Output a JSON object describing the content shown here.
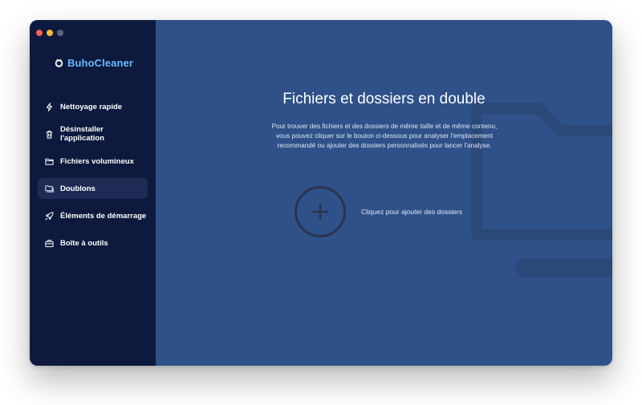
{
  "window": {
    "traffic_lights": [
      "red",
      "yellow",
      "gray"
    ]
  },
  "sidebar": {
    "brand": "BuhoCleaner",
    "items": [
      {
        "label": "Nettoyage rapide",
        "icon": "lightning-icon",
        "active": false
      },
      {
        "label": "Désinstaller l'application",
        "icon": "trash-icon",
        "active": false
      },
      {
        "label": "Fichiers volumineux",
        "icon": "folder-icon",
        "active": false
      },
      {
        "label": "Doublons",
        "icon": "duplicate-folder-icon",
        "active": true
      },
      {
        "label": "Éléments de démarrage",
        "icon": "rocket-icon",
        "active": false
      },
      {
        "label": "Boîte à outils",
        "icon": "toolbox-icon",
        "active": false
      }
    ]
  },
  "main": {
    "title": "Fichiers et dossiers en double",
    "description": "Pour trouver des fichiers et des dossiers de même taille et de même contenu, vous pouvez cliquer sur le bouton ci-dessous pour analyser l'emplacement recommandé ou ajouter des dossiers personnalisés pour lancer l'analyse.",
    "add_button_icon": "plus-icon",
    "add_label": "Cliquez pour ajouter des dossiers"
  },
  "colors": {
    "sidebar_bg": "#0d1a3d",
    "main_bg": "#2f5189",
    "brand": "#6ab7ff",
    "active_item_bg": "#1e2c55"
  }
}
